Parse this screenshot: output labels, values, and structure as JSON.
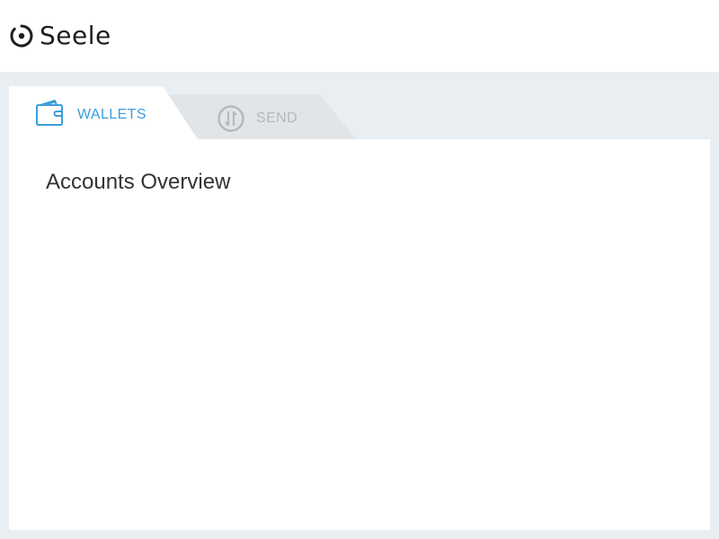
{
  "brand": {
    "name": "Seele",
    "logo_icon": "seele-logo-icon"
  },
  "tabs": [
    {
      "label": "WALLETS",
      "icon": "wallet-icon",
      "active": true
    },
    {
      "label": "SEND",
      "icon": "send-transfer-icon",
      "active": false
    }
  ],
  "main": {
    "title": "Accounts Overview"
  },
  "colors": {
    "accent": "#3a9fda",
    "background": "#e9eef2",
    "inactive_tab": "#e1e5e8",
    "inactive_text": "#b3b9bd",
    "title_text": "#333333"
  }
}
